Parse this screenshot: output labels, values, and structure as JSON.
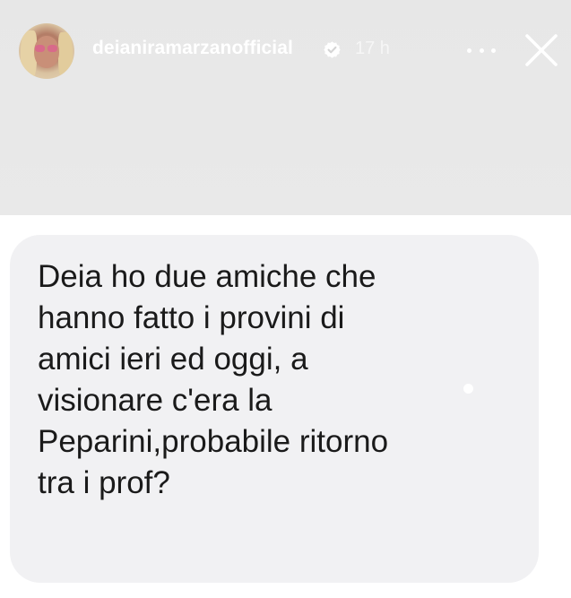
{
  "header": {
    "username": "deianiramarzanofficial",
    "time_ago": "17 h",
    "avatar_icon": "profile-photo",
    "verified_icon": "verified-badge-icon",
    "more_icon": "more-options-icon",
    "close_icon": "close-icon"
  },
  "message": {
    "text": "Deia ho due amiche che\nhanno fatto i provini di\namici ieri ed oggi, a\nvisionare c'era la\nPeparini,probabile ritorno\ntra i prof?"
  },
  "colors": {
    "top_background": "#e8e8e8",
    "bubble_background": "#f1f1f3",
    "message_text": "#1a1a1a",
    "header_text": "#ffffff"
  }
}
